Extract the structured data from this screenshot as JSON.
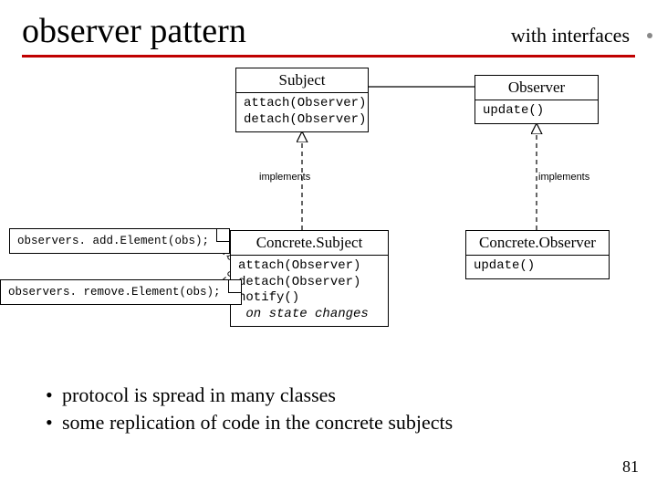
{
  "title": "observer pattern",
  "subtitle": "with interfaces",
  "page_number": "81",
  "labels": {
    "implements_left": "implements",
    "implements_right": "implements"
  },
  "boxes": {
    "subject": {
      "name": "Subject",
      "line1": "attach(Observer)",
      "line2": "detach(Observer)"
    },
    "observer": {
      "name": "Observer",
      "line1": "update()"
    },
    "concrete_subject": {
      "name": "Concrete.Subject",
      "line1": "attach(Observer)",
      "line2": "detach(Observer)",
      "line3": "notify()",
      "line4_italic": "on state changes"
    },
    "concrete_observer": {
      "name": "Concrete.Observer",
      "line1": "update()"
    }
  },
  "notes": {
    "add": "observers. add.Element(obs);",
    "remove": "observers. remove.Element(obs);"
  },
  "bullets": {
    "b1": "protocol is spread in many classes",
    "b2": "some replication of code in the concrete subjects"
  }
}
